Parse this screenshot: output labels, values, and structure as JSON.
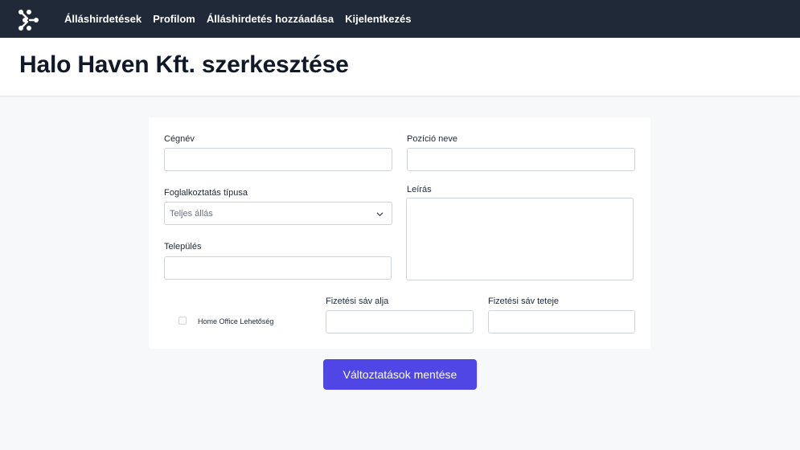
{
  "nav": {
    "links": [
      "Álláshirdetések",
      "Profilom",
      "Álláshirdetés hozzáadása",
      "Kijelentkezés"
    ]
  },
  "header": {
    "title": "Halo Haven Kft. szerkesztése"
  },
  "form": {
    "company_label": "Cégnév",
    "company_value": "",
    "position_label": "Pozíció neve",
    "position_value": "",
    "employment_label": "Foglalkoztatás típusa",
    "employment_selected": "Teljes állás",
    "description_label": "Leírás",
    "description_value": "",
    "city_label": "Település",
    "city_value": "",
    "home_office_label": "Home Office Lehetőség",
    "home_office_checked": false,
    "salary_min_label": "Fizetési sáv alja",
    "salary_min_value": "",
    "salary_max_label": "Fizetési sáv teteje",
    "salary_max_value": "",
    "save_label": "Változtatások mentése"
  },
  "colors": {
    "nav_bg": "#1f2937",
    "accent": "#4f46e5"
  }
}
